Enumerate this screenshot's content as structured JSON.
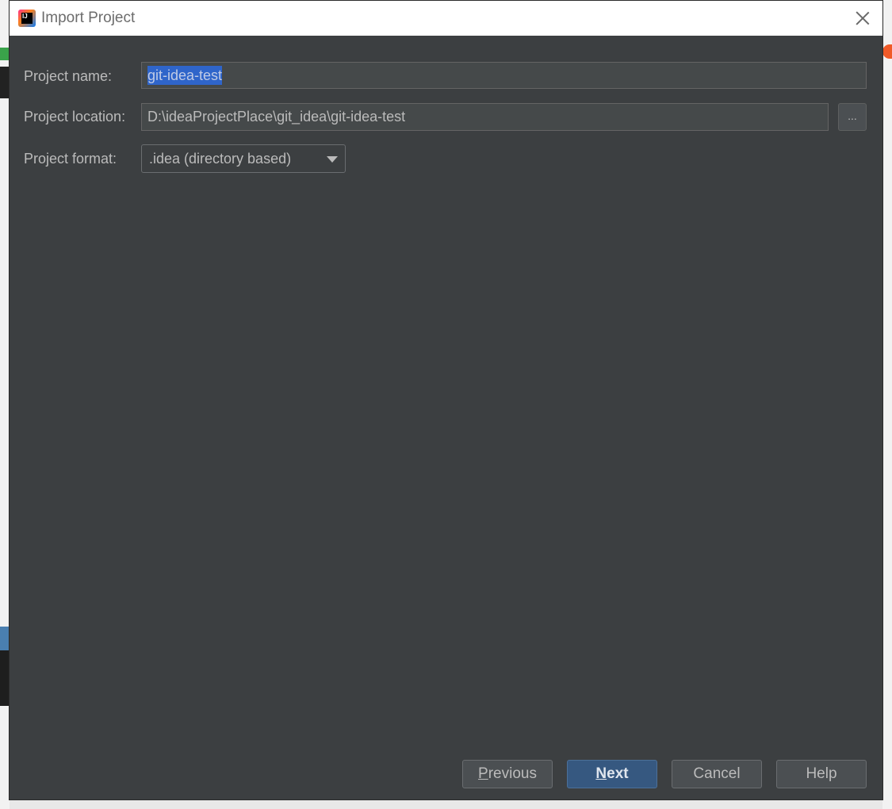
{
  "dialog": {
    "title": "Import Project",
    "icon": "intellij-idea-icon"
  },
  "form": {
    "project_name": {
      "label": "Project name:",
      "value": "git-idea-test"
    },
    "project_location": {
      "label": "Project location:",
      "value": "D:\\ideaProjectPlace\\git_idea\\git-idea-test",
      "browse_label": "..."
    },
    "project_format": {
      "label": "Project format:",
      "selected": ".idea (directory based)"
    }
  },
  "buttons": {
    "previous": {
      "mnemonic": "P",
      "rest": "revious"
    },
    "next": {
      "mnemonic": "N",
      "rest": "ext"
    },
    "cancel": "Cancel",
    "help": "Help"
  },
  "colors": {
    "dialog_bg": "#3c3f41",
    "field_bg": "#45494a",
    "selection": "#2f65ca",
    "primary_button": "#365880",
    "text": "#bbbbbb"
  }
}
